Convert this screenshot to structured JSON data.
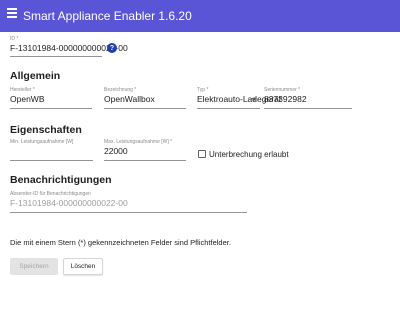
{
  "app": {
    "title": "Smart Appliance Enabler 1.6.20"
  },
  "id_field": {
    "label": "ID *",
    "value": "F-13101984-000000000022-00"
  },
  "sections": {
    "general": "Allgemein",
    "properties": "Eigenschaften",
    "notifications": "Benachrichtigungen"
  },
  "general": {
    "manufacturer": {
      "label": "Hersteller *",
      "value": "OpenWB"
    },
    "designation": {
      "label": "Bezeichnung *",
      "value": "OpenWallbox"
    },
    "type": {
      "label": "Typ *",
      "value": "Elektroauto-Ladegerät"
    },
    "serial": {
      "label": "Seriennummer *",
      "value": "837392982"
    }
  },
  "properties": {
    "min_power": {
      "label": "Min. Leistungsaufnahme [W]",
      "value": ""
    },
    "max_power": {
      "label": "Max. Leistungsaufnahme [W] *",
      "value": "22000"
    },
    "interruption_allowed": {
      "label": "Unterbrechung erlaubt",
      "checked": false
    }
  },
  "notifications": {
    "sender_id": {
      "label": "Absender-ID für Benachrichtigungen",
      "placeholder": "F-13101984-000000000022-00"
    }
  },
  "note": "Die mit einem Stern (*) gekennzeichneten Felder sind Pflichtfelder.",
  "buttons": {
    "save": "Speichern",
    "delete": "Löschen"
  },
  "colors": {
    "toolbar": "#5a55d6",
    "help_icon": "#1f3ea8"
  },
  "icons": {
    "menu": "menu-icon",
    "help": "help-icon",
    "dropdown": "chevron-down-icon"
  }
}
